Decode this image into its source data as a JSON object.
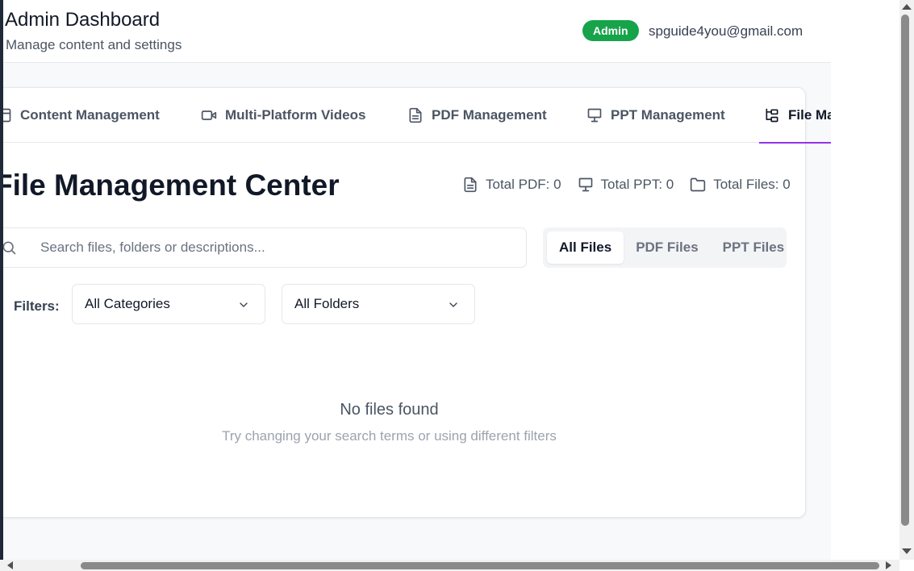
{
  "header": {
    "title": "Admin Dashboard",
    "subtitle": "Manage content and settings",
    "role_badge": "Admin",
    "email": "spguide4you@gmail.com"
  },
  "tabs": [
    {
      "label": "Content Management",
      "icon": "content-icon",
      "active": false
    },
    {
      "label": "Multi-Platform Videos",
      "icon": "video-icon",
      "active": false
    },
    {
      "label": "PDF Management",
      "icon": "file-text-icon",
      "active": false
    },
    {
      "label": "PPT Management",
      "icon": "presentation-icon",
      "active": false
    },
    {
      "label": "File Management",
      "icon": "folder-tree-icon",
      "active": true
    }
  ],
  "section": {
    "title": "File Management Center",
    "stats": [
      {
        "label": "Total PDF: 0",
        "icon": "file-text-icon"
      },
      {
        "label": "Total PPT: 0",
        "icon": "presentation-icon"
      },
      {
        "label": "Total Files: 0",
        "icon": "folder-icon"
      }
    ]
  },
  "search": {
    "placeholder": "Search files, folders or descriptions...",
    "value": ""
  },
  "file_type_filter": {
    "options": [
      "All Files",
      "PDF Files",
      "PPT Files"
    ],
    "selected": "All Files"
  },
  "filters": {
    "label": "Filters:",
    "category_selected": "All Categories",
    "folder_selected": "All Folders"
  },
  "empty_state": {
    "title": "No files found",
    "hint": "Try changing your search terms or using different filters"
  },
  "colors": {
    "accent": "#9333ea",
    "badge": "#16a34a"
  }
}
